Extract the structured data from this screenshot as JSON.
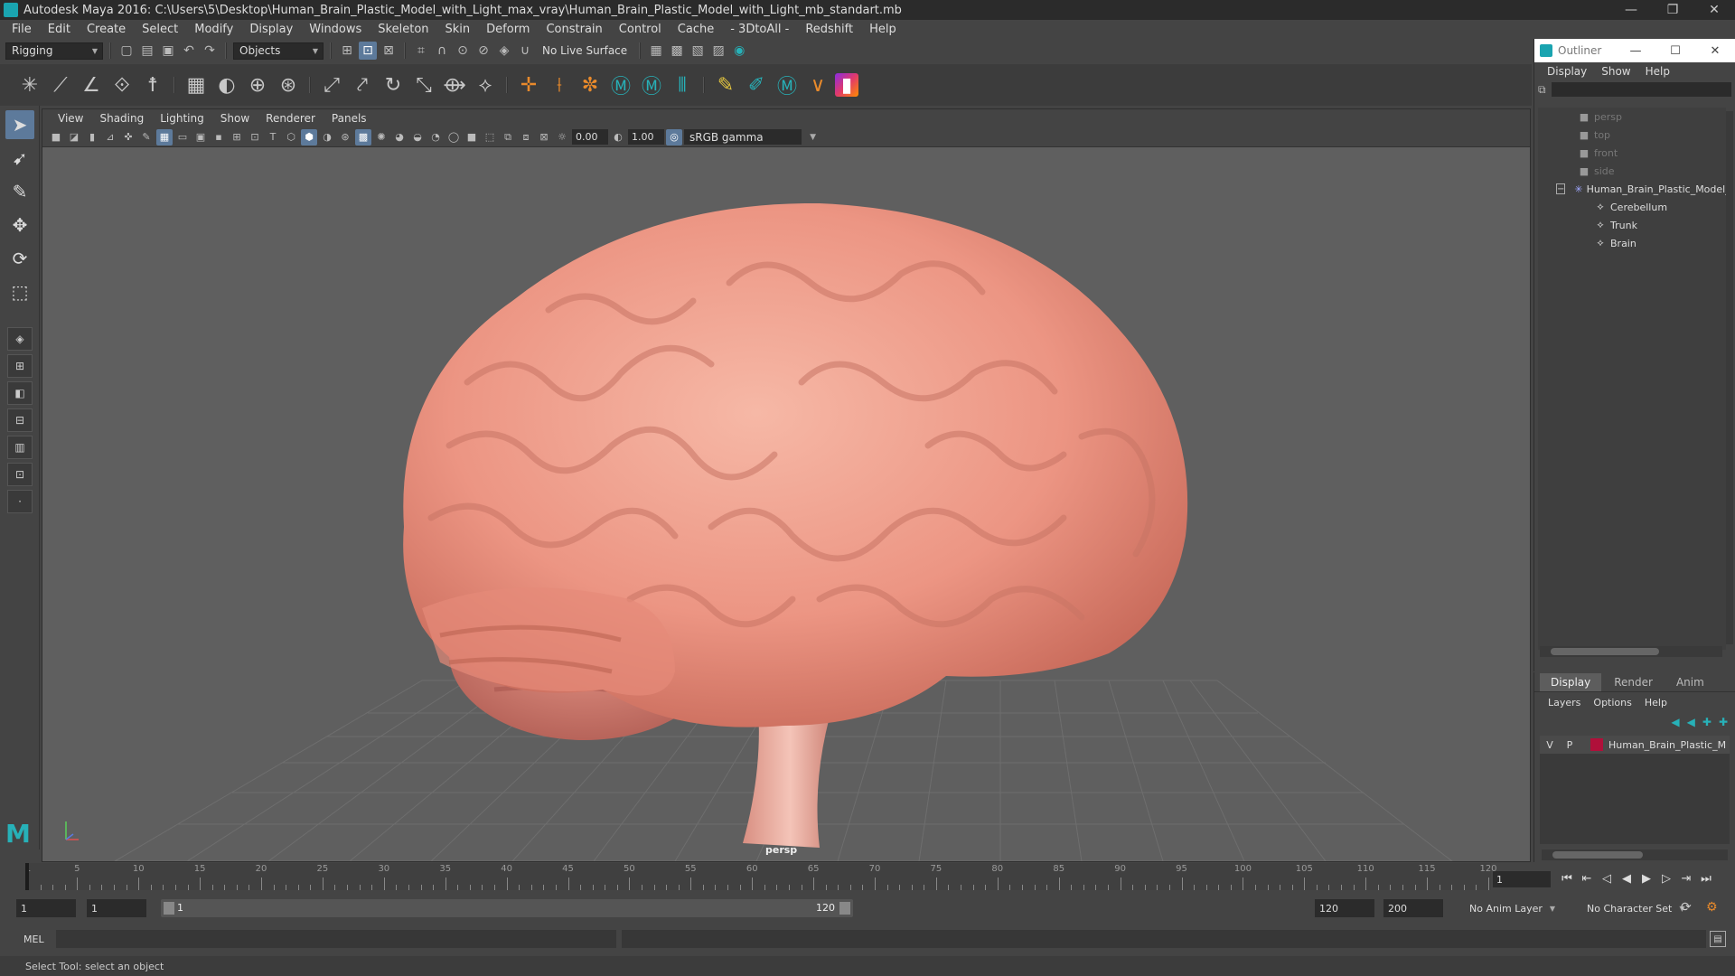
{
  "window": {
    "title": "Autodesk Maya 2016: C:\\Users\\5\\Desktop\\Human_Brain_Plastic_Model_with_Light_max_vray\\Human_Brain_Plastic_Model_with_Light_mb_standart.mb",
    "minimize": "—",
    "maximize": "❐",
    "close": "✕"
  },
  "menubar": {
    "items": [
      "File",
      "Edit",
      "Create",
      "Select",
      "Modify",
      "Display",
      "Windows",
      "Skeleton",
      "Skin",
      "Deform",
      "Constrain",
      "Control",
      "Cache",
      "- 3DtoAll -",
      "Redshift",
      "Help"
    ]
  },
  "statusline": {
    "menuset": "Rigging",
    "selection_mode": "Objects",
    "live_surface": "No Live Surface"
  },
  "viewport": {
    "menu": [
      "View",
      "Shading",
      "Lighting",
      "Show",
      "Renderer",
      "Panels"
    ],
    "exposure": "0.00",
    "gamma": "1.00",
    "color_space": "sRGB gamma",
    "camera": "persp"
  },
  "outliner": {
    "title": "Outliner",
    "menu": [
      "Display",
      "Show",
      "Help"
    ],
    "cameras": [
      "persp",
      "top",
      "front",
      "side"
    ],
    "group": "Human_Brain_Plastic_Model_",
    "children": [
      "Cerebellum",
      "Trunk",
      "Brain"
    ]
  },
  "layers": {
    "tabs": [
      "Display",
      "Render",
      "Anim"
    ],
    "active_tab": "Display",
    "menu": [
      "Layers",
      "Options",
      "Help"
    ],
    "row": {
      "v": "V",
      "p": "P",
      "name": "Human_Brain_Plastic_M",
      "color": "#b0103a"
    }
  },
  "timeslider": {
    "ticks": [
      "1",
      "5",
      "10",
      "15",
      "20",
      "25",
      "30",
      "35",
      "40",
      "45",
      "50",
      "55",
      "60",
      "65",
      "70",
      "75",
      "80",
      "85",
      "90",
      "95",
      "100",
      "105",
      "110",
      "115",
      "120"
    ],
    "current_frame": "1"
  },
  "range": {
    "start": "1",
    "playback_start": "1",
    "slider_start": "1",
    "slider_end": "120",
    "playback_end": "120",
    "end": "200",
    "anim_layer": "No Anim Layer",
    "character_set": "No Character Set"
  },
  "cmdline": {
    "label": "MEL"
  },
  "helpline": {
    "text": "Select Tool: select an object"
  },
  "colors": {
    "accent": "#5d7a9b",
    "maya_teal": "#27b1b8",
    "layer_color": "#b0103a"
  }
}
